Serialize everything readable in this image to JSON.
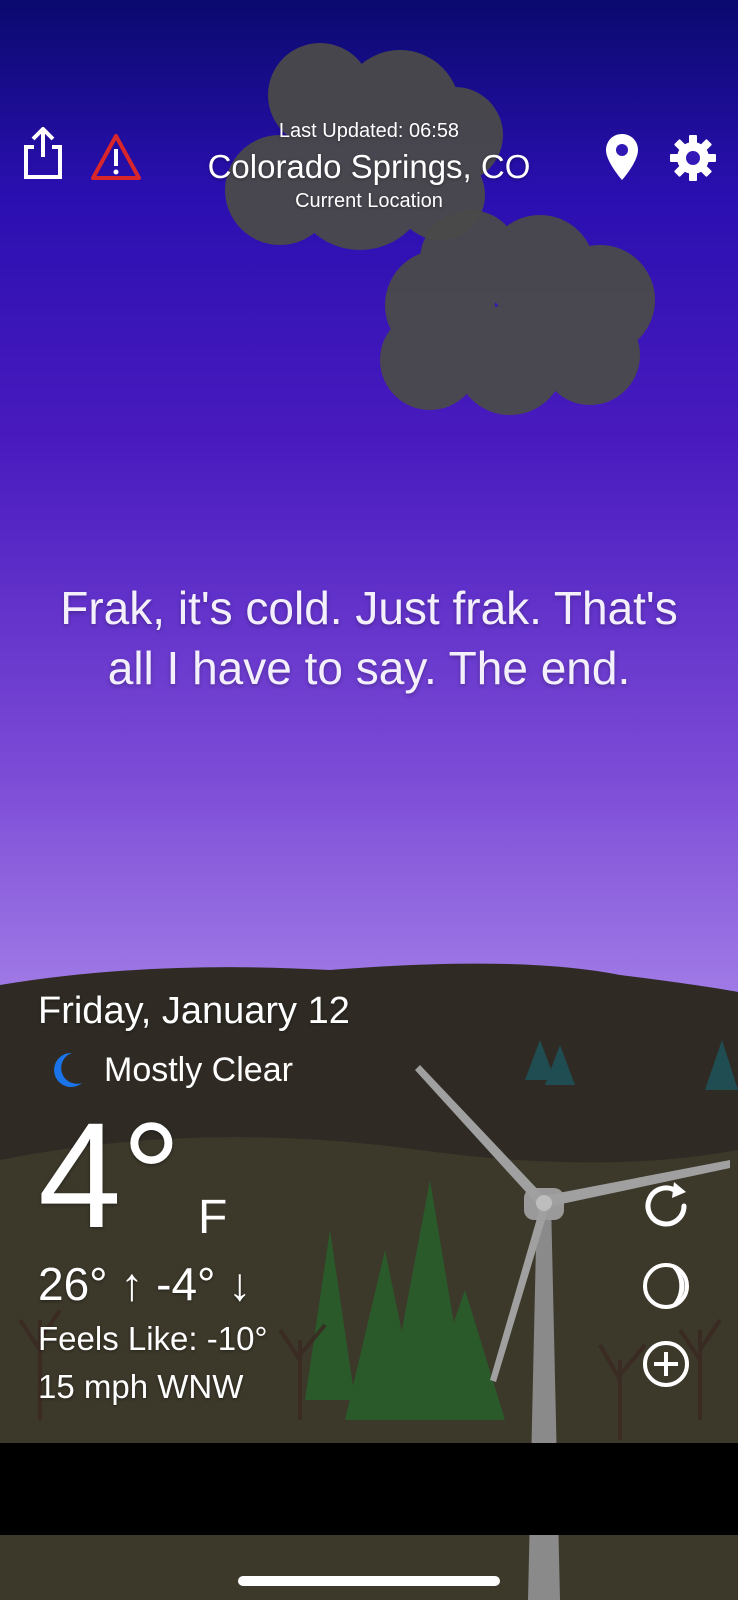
{
  "header": {
    "last_updated": "Last Updated: 06:58",
    "location": "Colorado Springs, CO",
    "location_type": "Current Location",
    "left_icons": [
      "share-icon",
      "warning-icon"
    ],
    "right_icons": [
      "location-pin-icon",
      "settings-gear-icon"
    ]
  },
  "quip": "Frak, it's cold. Just frak. That's all I have to say. The end.",
  "weather": {
    "date": "Friday, January 12",
    "condition": "Mostly Clear",
    "condition_icon": "moon-icon",
    "temperature": "4°",
    "unit": "F",
    "high_low": "26° ↑ -4° ↓",
    "feels_like": "Feels Like: -10°",
    "wind": "15 mph WNW"
  },
  "side_actions": [
    "refresh-icon",
    "radar-icon",
    "add-icon"
  ],
  "colors": {
    "sky_top": "#0a0a6e",
    "sky_bottom": "#b79af0",
    "ground": "#2e2a24",
    "alert_red": "#d9262b",
    "moon_blue": "#1a73e8"
  }
}
